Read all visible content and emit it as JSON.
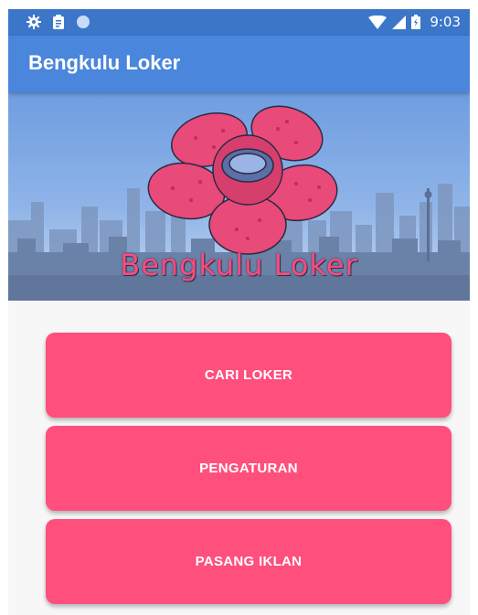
{
  "status_bar": {
    "time": "9:03",
    "icons": [
      "settings-icon",
      "clipboard-icon",
      "circle-icon",
      "wifi-icon",
      "signal-icon",
      "battery-icon"
    ]
  },
  "app_bar": {
    "title": "Bengkulu Loker"
  },
  "banner": {
    "text": "Bengkulu Loker"
  },
  "buttons": {
    "cari_loker": "CARI LOKER",
    "pengaturan": "PENGATURAN",
    "pasang_iklan": "PASANG IKLAN"
  },
  "colors": {
    "status_bar": "#3b76c9",
    "app_bar": "#4a86db",
    "button": "#ff4f7d",
    "flower": "#e84a7a"
  }
}
